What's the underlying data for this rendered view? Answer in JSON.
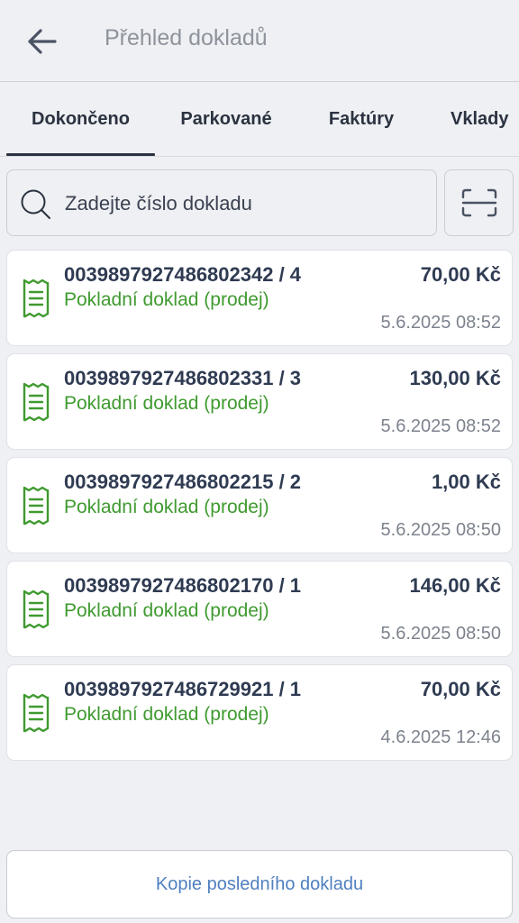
{
  "header": {
    "title": "Přehled dokladů",
    "back_icon": "arrow-left-icon"
  },
  "tabs": [
    {
      "label": "Dokončeno",
      "active": true
    },
    {
      "label": "Parkované",
      "active": false
    },
    {
      "label": "Faktúry",
      "active": false
    },
    {
      "label": "Vklady",
      "active": false
    }
  ],
  "search": {
    "placeholder": "Zadejte číslo dokladu",
    "value": "",
    "icon": "search-icon"
  },
  "scan": {
    "icon": "scan-icon"
  },
  "receipts": [
    {
      "number": "0039897927486802342 / 4",
      "type": "Pokladní doklad (prodej)",
      "amount": "70,00 Kč",
      "date": "5.6.2025 08:52"
    },
    {
      "number": "0039897927486802331 / 3",
      "type": "Pokladní doklad (prodej)",
      "amount": "130,00 Kč",
      "date": "5.6.2025 08:52"
    },
    {
      "number": "0039897927486802215 / 2",
      "type": "Pokladní doklad (prodej)",
      "amount": "1,00 Kč",
      "date": "5.6.2025 08:50"
    },
    {
      "number": "0039897927486802170 / 1",
      "type": "Pokladní doklad (prodej)",
      "amount": "146,00 Kč",
      "date": "5.6.2025 08:50"
    },
    {
      "number": "0039897927486729921 / 1",
      "type": "Pokladní doklad (prodej)",
      "amount": "70,00 Kč",
      "date": "4.6.2025 12:46"
    }
  ],
  "footer": {
    "copy_last_label": "Kopie posledního dokladu"
  },
  "colors": {
    "accent_green": "#3f9a2f",
    "link_blue": "#4f7fbf",
    "text_dark": "#2f3b52"
  }
}
